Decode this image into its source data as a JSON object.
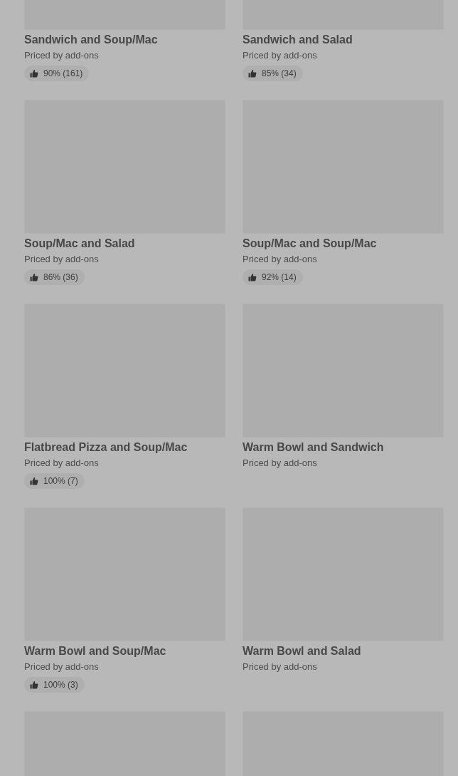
{
  "cards": [
    {
      "kind": "item",
      "title": "Sandwich and Soup/Mac",
      "subtitle": "Priced by add-ons",
      "rating": "90% (161)"
    },
    {
      "kind": "item",
      "title": "Sandwich and Salad",
      "subtitle": "Priced by add-ons",
      "rating": "85% (34)"
    },
    {
      "kind": "item",
      "title": "Soup/Mac and Salad",
      "subtitle": "Priced by add-ons",
      "rating": "86% (36)"
    },
    {
      "kind": "item",
      "title": "Soup/Mac and Soup/Mac",
      "subtitle": "Priced by add-ons",
      "rating": "92% (14)"
    },
    {
      "kind": "item",
      "title": "Flatbread Pizza and Soup/Mac",
      "subtitle": "Priced by add-ons",
      "rating": "100% (7)"
    },
    {
      "kind": "item",
      "title": "Warm Bowl and Sandwich",
      "subtitle": "Priced by add-ons"
    },
    {
      "kind": "item",
      "title": "Warm Bowl and Soup/Mac",
      "subtitle": "Priced by add-ons",
      "rating": "100% (3)"
    },
    {
      "kind": "item",
      "title": "Warm Bowl and Salad",
      "subtitle": "Priced by add-ons"
    },
    {
      "kind": "picture"
    },
    {
      "kind": "picture"
    }
  ]
}
